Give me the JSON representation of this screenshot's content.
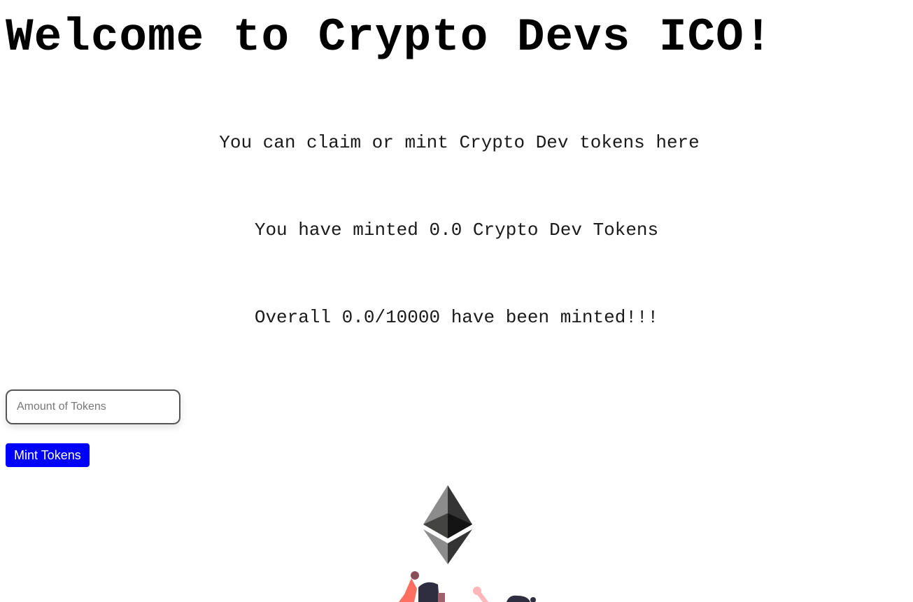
{
  "header": {
    "title": "Welcome to Crypto Devs ICO!"
  },
  "main": {
    "description": "You can claim or mint Crypto Dev tokens here",
    "minted_by_user": "You have minted 0.0 Crypto Dev Tokens",
    "overall_minted": "Overall 0.0/10000 have been minted!!!"
  },
  "mint_form": {
    "amount_placeholder": "Amount of Tokens",
    "amount_value": "",
    "mint_button_label": "Mint Tokens"
  },
  "illustration": {
    "icon": "ethereum-logo-icon",
    "colors": {
      "eth_dark": "#343434",
      "eth_mid": "#8c8c8c",
      "eth_light": "#3c3c3b",
      "figure_orange": "#ff6f61",
      "figure_pink": "#ffb6b9",
      "figure_dark": "#2f2e41"
    }
  },
  "colors": {
    "button_bg": "#0000ff",
    "button_text": "#ffffff",
    "text": "#000000"
  }
}
